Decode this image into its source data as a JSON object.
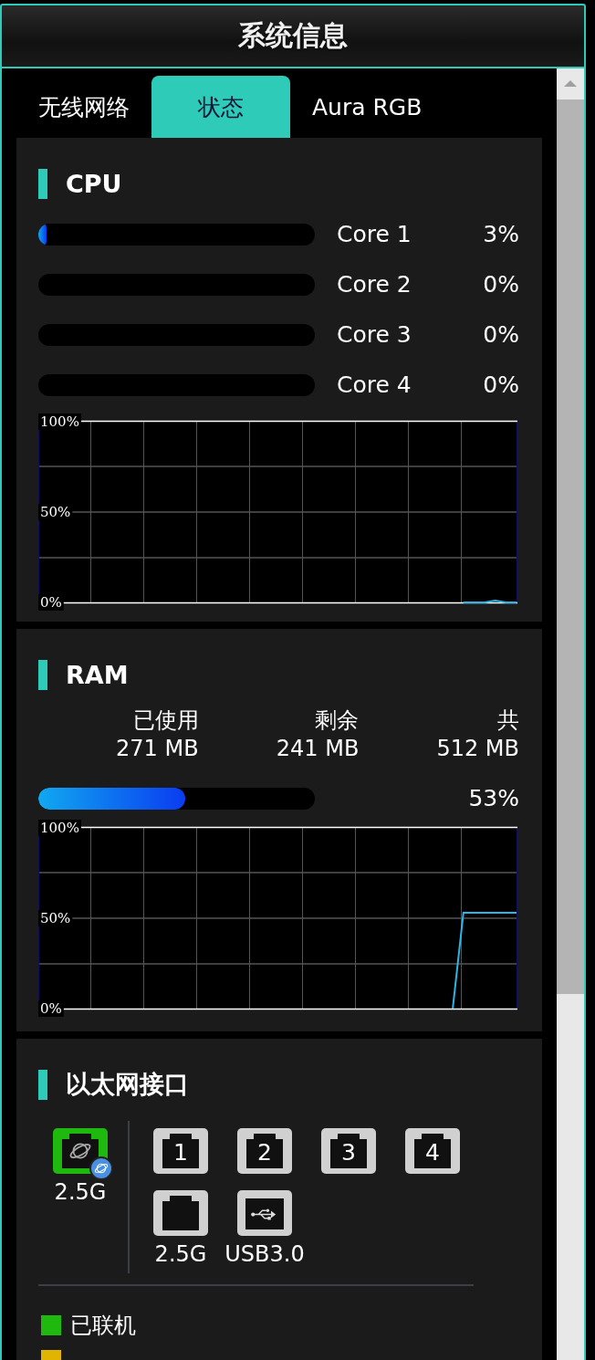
{
  "window": {
    "title": "系统信息"
  },
  "tabs": [
    {
      "label": "无线网络",
      "selected": false
    },
    {
      "label": "状态",
      "selected": true
    },
    {
      "label": "Aura RGB",
      "selected": false
    }
  ],
  "cpu": {
    "title": "CPU",
    "cores": [
      {
        "name": "Core 1",
        "level": 0.03,
        "reading": "3%"
      },
      {
        "name": "Core 2",
        "reading": "0%"
      },
      {
        "name": "Core 3",
        "reading": "0%"
      },
      {
        "name": "Core 4",
        "reading": "0%"
      }
    ],
    "chart_data": {
      "type": "line",
      "grid": true,
      "categories": [
        null,
        null,
        null,
        null,
        null,
        null,
        null,
        null,
        null,
        null,
        null,
        null,
        null,
        null,
        null,
        null,
        null,
        null,
        null,
        null,
        null,
        null,
        null,
        null,
        null,
        null,
        null,
        null,
        null,
        null,
        null,
        null,
        null,
        null,
        null,
        null,
        null,
        null,
        null,
        null,
        null,
        null,
        null,
        null,
        null,
        null
      ],
      "ylim": [
        0,
        100
      ],
      "yticks": [
        {
          "value": 0,
          "label": "0%"
        },
        {
          "value": 50,
          "label": "50%"
        },
        {
          "value": 100,
          "label": "100%"
        }
      ],
      "series": [
        {
          "color": "#29b6e8",
          "values": [
            null,
            null,
            null,
            null,
            null,
            null,
            null,
            null,
            null,
            null,
            null,
            null,
            null,
            null,
            null,
            null,
            null,
            null,
            null,
            null,
            null,
            null,
            null,
            null,
            null,
            null,
            null,
            null,
            null,
            null,
            null,
            null,
            null,
            null,
            null,
            null,
            null,
            null,
            null,
            null,
            0,
            0,
            0,
            1,
            0,
            0
          ]
        }
      ]
    }
  },
  "ram": {
    "title": "RAM",
    "stats": [
      {
        "label": "已使用",
        "value": "271 MB"
      },
      {
        "label": "剩余",
        "value": "241 MB"
      },
      {
        "label": "共",
        "value": "512 MB"
      }
    ],
    "level": 0.53,
    "reading": "53%",
    "chart_data": {
      "type": "line",
      "grid": true,
      "categories": [
        null,
        null,
        null,
        null,
        null,
        null,
        null,
        null,
        null,
        null,
        null,
        null,
        null,
        null,
        null,
        null,
        null,
        null,
        null,
        null,
        null,
        null,
        null,
        null,
        null,
        null,
        null,
        null,
        null,
        null,
        null,
        null,
        null,
        null,
        null,
        null,
        null,
        null,
        null,
        null,
        null,
        null,
        null,
        null,
        null,
        null
      ],
      "ylim": [
        0,
        100
      ],
      "yticks": [
        {
          "value": 0,
          "label": "0%"
        },
        {
          "value": 50,
          "label": "50%"
        },
        {
          "value": 100,
          "label": "100%"
        }
      ],
      "series": [
        {
          "color": "#29b6e8",
          "values": [
            null,
            null,
            null,
            null,
            null,
            null,
            null,
            null,
            null,
            null,
            null,
            null,
            null,
            null,
            null,
            null,
            null,
            null,
            null,
            null,
            null,
            null,
            null,
            null,
            null,
            null,
            null,
            null,
            null,
            null,
            null,
            null,
            null,
            null,
            null,
            null,
            null,
            null,
            null,
            0,
            53,
            53,
            53,
            53,
            53,
            53
          ]
        }
      ]
    }
  },
  "ethernet": {
    "title": "以太网接口",
    "wan": {
      "kind": "wan",
      "color": "#1fb80f",
      "label": "2.5G"
    },
    "ports": [
      {
        "kind": "lan",
        "color": "#d0d0d0",
        "number": "1"
      },
      {
        "kind": "lan",
        "color": "#d0d0d0",
        "number": "2"
      },
      {
        "kind": "lan",
        "color": "#d0d0d0",
        "number": "3"
      },
      {
        "kind": "lan",
        "color": "#d0d0d0",
        "number": "4"
      },
      {
        "kind": "lan",
        "color": "#d0d0d0",
        "label": "2.5G"
      },
      {
        "kind": "usb",
        "color": "#d0d0d0",
        "label": "USB3.0"
      }
    ],
    "legend": [
      {
        "label": "已联机",
        "color": "#1fb80f"
      },
      {
        "color": "#e0b400"
      }
    ]
  }
}
